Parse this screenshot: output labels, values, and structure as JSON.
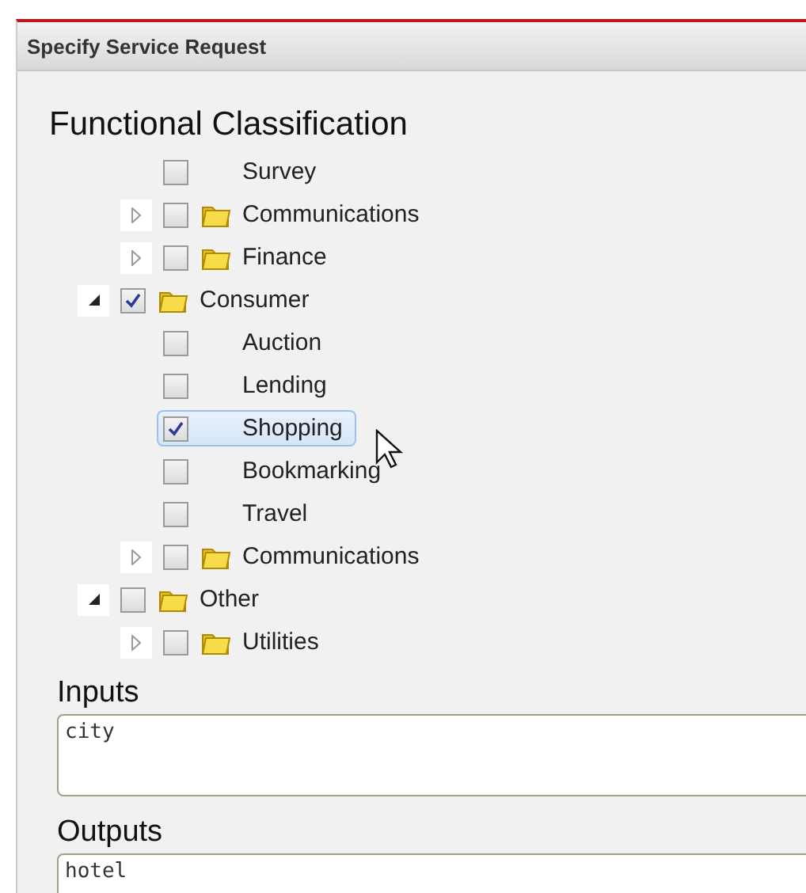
{
  "panel": {
    "title": "Specify Service Request"
  },
  "classification": {
    "heading": "Functional Classification",
    "continued": [
      {
        "kind": "leaf",
        "label": "Survey",
        "checked": false,
        "selected": false
      },
      {
        "kind": "folder",
        "label": "Communications",
        "checked": false,
        "selected": false,
        "expanded": false
      },
      {
        "kind": "folder",
        "label": "Finance",
        "checked": false,
        "selected": false,
        "expanded": false
      }
    ],
    "items": [
      {
        "kind": "folder",
        "label": "Consumer",
        "checked": true,
        "selected": false,
        "expanded": true,
        "children": [
          {
            "kind": "leaf",
            "label": "Auction",
            "checked": false,
            "selected": false
          },
          {
            "kind": "leaf",
            "label": "Lending",
            "checked": false,
            "selected": false
          },
          {
            "kind": "leaf",
            "label": "Shopping",
            "checked": true,
            "selected": true
          },
          {
            "kind": "leaf",
            "label": "Bookmarking",
            "checked": false,
            "selected": false
          },
          {
            "kind": "leaf",
            "label": "Travel",
            "checked": false,
            "selected": false
          },
          {
            "kind": "folder",
            "label": "Communications",
            "checked": false,
            "selected": false,
            "expanded": false
          }
        ]
      },
      {
        "kind": "folder",
        "label": "Other",
        "checked": false,
        "selected": false,
        "expanded": true,
        "children": [
          {
            "kind": "folder",
            "label": "Utilities",
            "checked": false,
            "selected": false,
            "expanded": false
          }
        ]
      }
    ]
  },
  "inputs": {
    "label": "Inputs",
    "value": "city"
  },
  "outputs": {
    "label": "Outputs",
    "value": "hotel"
  }
}
